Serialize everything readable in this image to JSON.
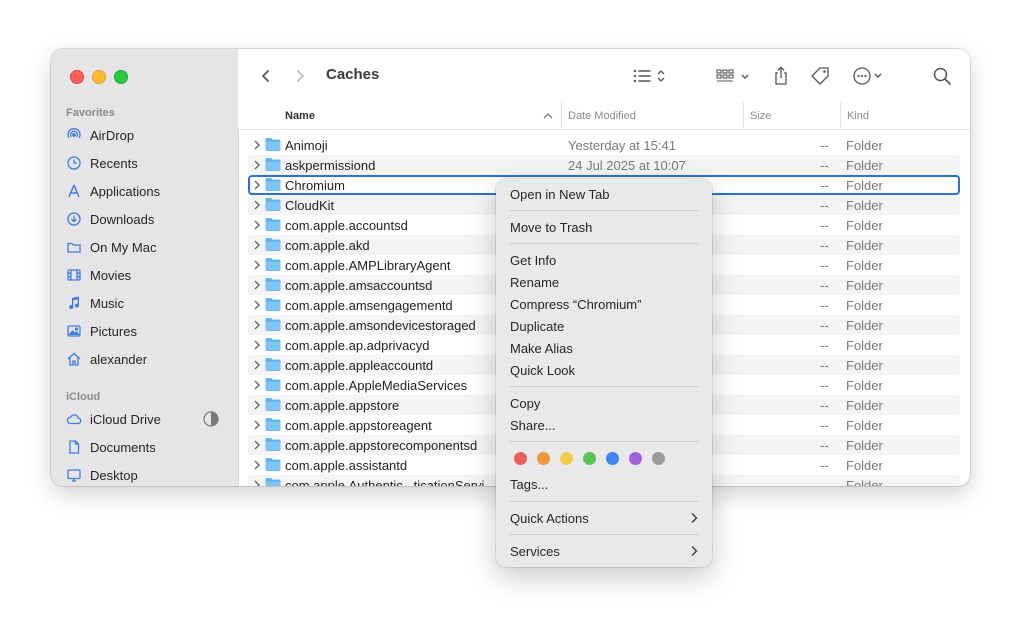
{
  "window": {
    "title": "Caches"
  },
  "sidebar": {
    "favorites_header": "Favorites",
    "favorites": [
      {
        "label": "AirDrop",
        "icon": "airdrop-icon"
      },
      {
        "label": "Recents",
        "icon": "clock-icon"
      },
      {
        "label": "Applications",
        "icon": "applications-icon"
      },
      {
        "label": "Downloads",
        "icon": "download-icon"
      },
      {
        "label": "On My Mac",
        "icon": "folder-icon"
      },
      {
        "label": "Movies",
        "icon": "film-icon"
      },
      {
        "label": "Music",
        "icon": "music-note-icon"
      },
      {
        "label": "Pictures",
        "icon": "photo-icon"
      },
      {
        "label": "alexander",
        "icon": "home-icon"
      }
    ],
    "icloud_header": "iCloud",
    "icloud": [
      {
        "label": "iCloud Drive",
        "icon": "cloud-icon"
      },
      {
        "label": "Documents",
        "icon": "document-icon"
      },
      {
        "label": "Desktop",
        "icon": "desktop-icon"
      }
    ]
  },
  "columns": {
    "name": "Name",
    "date_modified": "Date Modified",
    "size": "Size",
    "kind": "Kind"
  },
  "rows": [
    {
      "name": "Animoji",
      "date": "Yesterday at 15:41",
      "size": "--",
      "kind": "Folder"
    },
    {
      "name": "askpermissiond",
      "date": "24 Jul 2025 at 10:07",
      "size": "--",
      "kind": "Folder"
    },
    {
      "name": "Chromium",
      "date": "",
      "size": "--",
      "kind": "Folder"
    },
    {
      "name": "CloudKit",
      "date": "",
      "size": "--",
      "kind": "Folder"
    },
    {
      "name": "com.apple.accountsd",
      "date": "",
      "size": "--",
      "kind": "Folder"
    },
    {
      "name": "com.apple.akd",
      "date": "",
      "size": "--",
      "kind": "Folder"
    },
    {
      "name": "com.apple.AMPLibraryAgent",
      "date": "",
      "size": "--",
      "kind": "Folder"
    },
    {
      "name": "com.apple.amsaccountsd",
      "date": "",
      "size": "--",
      "kind": "Folder"
    },
    {
      "name": "com.apple.amsengagementd",
      "date": "",
      "size": "--",
      "kind": "Folder"
    },
    {
      "name": "com.apple.amsondevicestoraged",
      "date": "",
      "size": "--",
      "kind": "Folder"
    },
    {
      "name": "com.apple.ap.adprivacyd",
      "date": "",
      "size": "--",
      "kind": "Folder"
    },
    {
      "name": "com.apple.appleaccountd",
      "date": "",
      "size": "--",
      "kind": "Folder"
    },
    {
      "name": "com.apple.AppleMediaServices",
      "date": "",
      "size": "--",
      "kind": "Folder"
    },
    {
      "name": "com.apple.appstore",
      "date": "",
      "size": "--",
      "kind": "Folder"
    },
    {
      "name": "com.apple.appstoreagent",
      "date": "",
      "size": "--",
      "kind": "Folder"
    },
    {
      "name": "com.apple.appstorecomponentsd",
      "date": "",
      "size": "--",
      "kind": "Folder"
    },
    {
      "name": "com.apple.assistantd",
      "date": "",
      "size": "--",
      "kind": "Folder"
    },
    {
      "name": "com.apple.Authentic...ticationServi",
      "date": "",
      "size": "--",
      "kind": "Folder"
    }
  ],
  "selected_row": 2,
  "context_menu": {
    "open_new_tab": "Open in New Tab",
    "move_to_trash": "Move to Trash",
    "get_info": "Get Info",
    "rename": "Rename",
    "compress": "Compress “Chromium”",
    "duplicate": "Duplicate",
    "make_alias": "Make Alias",
    "quick_look": "Quick Look",
    "copy": "Copy",
    "share": "Share...",
    "tag_colors": [
      "#ec5f5a",
      "#f0983f",
      "#f5c94a",
      "#5cc559",
      "#3e86ee",
      "#a461d8",
      "#9b9b9b"
    ],
    "tags": "Tags...",
    "quick_actions": "Quick Actions",
    "services": "Services"
  }
}
